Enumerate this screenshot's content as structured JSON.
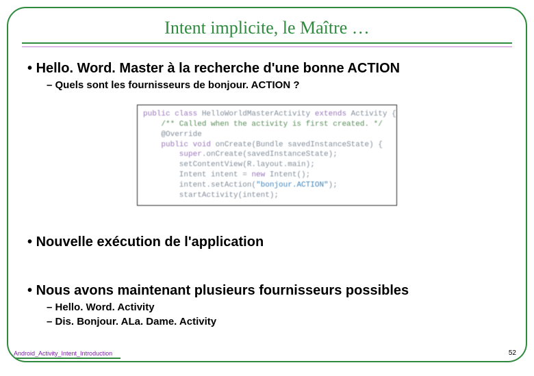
{
  "title": "Intent implicite, le Maître …",
  "bullets": {
    "b1": "Hello. Word. Master à la recherche d'une bonne ACTION",
    "b1s1": "Quels sont les fournisseurs de bonjour. ACTION ?",
    "b2": "Nouvelle exécution de l'application",
    "b3": "Nous avons maintenant plusieurs fournisseurs possibles",
    "b3s1": "Hello. Word. Activity",
    "b3s2": "Dis. Bonjour. ALa. Dame. Activity"
  },
  "code": {
    "l1a": "public class",
    "l1b": " HelloWorldMasterActivity ",
    "l1c": "extends",
    "l1d": " Activity {",
    "l2": "    /** Called when the activity is first created. */",
    "l3": "    @Override",
    "l4a": "    public void",
    "l4b": " onCreate(Bundle savedInstanceState) {",
    "l5a": "        super",
    "l5b": ".onCreate(savedInstanceState);",
    "l6": "        setContentView(R.layout.main);",
    "l7a": "        Intent intent = ",
    "l7b": "new",
    "l7c": " Intent();",
    "l8a": "        intent.setAction(",
    "l8b": "\"bonjour.ACTION\"",
    "l8c": ");",
    "l9": "        startActivity(intent);"
  },
  "footer": {
    "left": "Android_Activity_Intent_Introduction",
    "page": "52"
  }
}
